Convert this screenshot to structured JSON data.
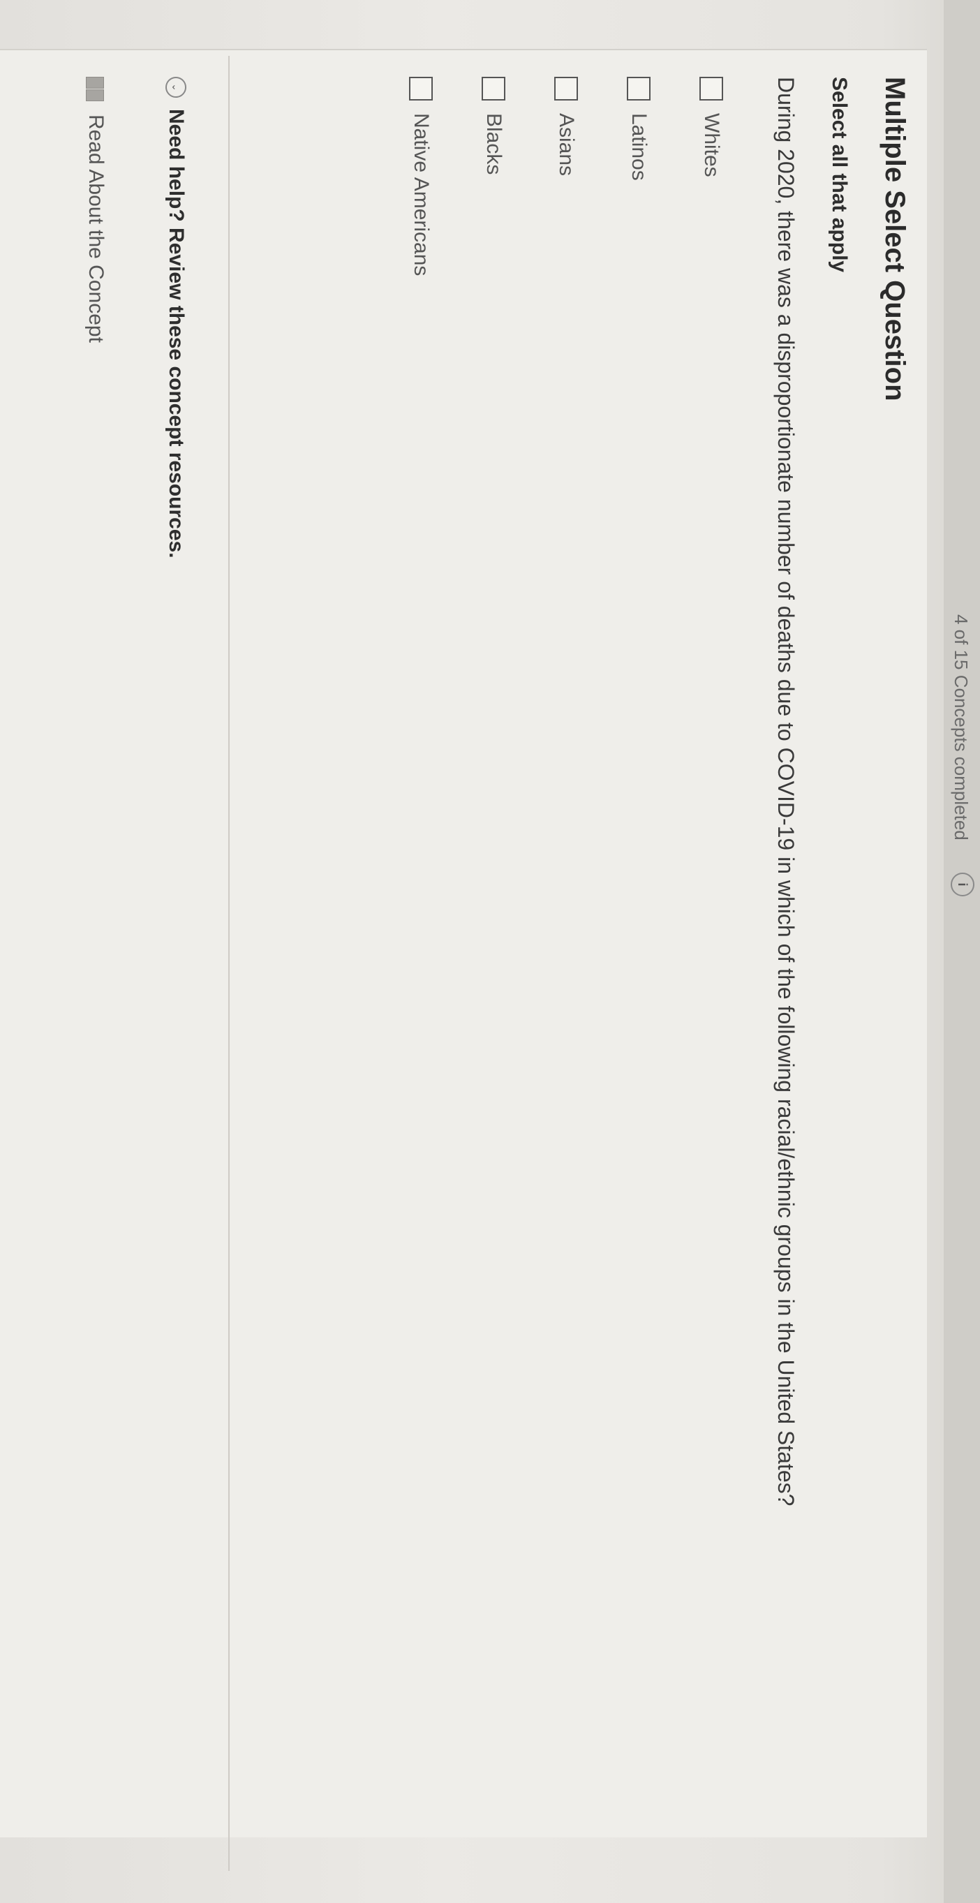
{
  "header": {
    "progress_text": "4 of 15 Concepts completed",
    "info_icon_glyph": "i"
  },
  "question": {
    "heading": "Multiple Select Question",
    "instruction": "Select all that apply",
    "prompt": "During 2020, there was a disproportionate number of deaths due to COVID-19 in which of the following racial/ethnic groups in the United States?",
    "options": [
      {
        "label": "Whites",
        "checked": false
      },
      {
        "label": "Latinos",
        "checked": false
      },
      {
        "label": "Asians",
        "checked": false
      },
      {
        "label": "Blacks",
        "checked": false
      },
      {
        "label": "Native Americans",
        "checked": false
      }
    ]
  },
  "help": {
    "title": "Need help? Review these concept resources.",
    "chevron_glyph": "⌄",
    "resource_label": "Read About the Concept"
  },
  "icons": {
    "info": "info-icon",
    "chevron": "chevron-down-icon",
    "resource": "book-icon"
  }
}
